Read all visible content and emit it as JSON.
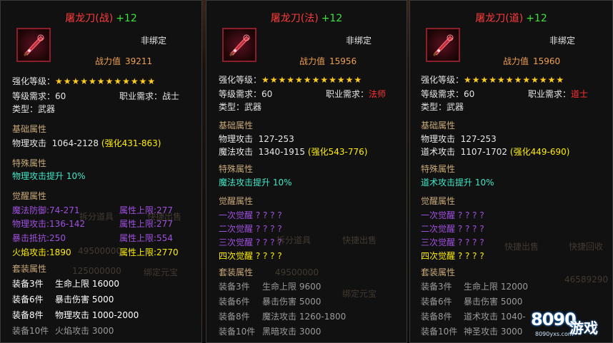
{
  "panels": [
    {
      "name": "屠龙刀(战)",
      "level": "+12",
      "bind": "非绑定",
      "power_label": "战力值",
      "power_value": "39211",
      "enhance_label": "强化等级：",
      "stars": "★★★★★★★★★★★★",
      "level_req": "等级需求：60",
      "class_req_label": "职业需求：",
      "class_req_value": "战士",
      "type": "类型：武器",
      "base_title": "基础属性",
      "base": [
        {
          "k": "物理攻击",
          "v": "1064-2128",
          "enh": "(强化431-863)"
        }
      ],
      "special_title": "特殊属性",
      "special": "物理攻击提升  10%",
      "awaken_title": "觉醒属性",
      "awaken": [
        [
          "魔法防御:74-271",
          "属性上限:277"
        ],
        [
          "物理攻击:136-142",
          "属性上限:277"
        ],
        [
          "暴击抵抗:250",
          "属性上限:554"
        ],
        [
          "火焰攻击:1890",
          "属性上限:2770"
        ]
      ],
      "set_title": "套装属性",
      "set": [
        {
          "k": "装备3件",
          "a": "生命上限",
          "v": "16000",
          "on": true
        },
        {
          "k": "装备6件",
          "a": "暴击伤害",
          "v": "5000",
          "on": true
        },
        {
          "k": "装备8件",
          "a": "物理攻击",
          "v": "1000-2000",
          "on": true
        },
        {
          "k": "装备10件",
          "a": "火焰攻击",
          "v": "3000",
          "on": false
        }
      ]
    },
    {
      "name": "屠龙刀(法)",
      "level": "+12",
      "bind": "非绑定",
      "power_label": "战力值",
      "power_value": "15956",
      "enhance_label": "强化等级：",
      "stars": "★★★★★★★★★★★★",
      "level_req": "等级需求：60",
      "class_req_label": "职业需求：",
      "class_req_value": "法师",
      "type": "类型：武器",
      "base_title": "基础属性",
      "base": [
        {
          "k": "物理攻击",
          "v": "127-253",
          "enh": ""
        },
        {
          "k": "魔法攻击",
          "v": "1340-1915",
          "enh": "(强化543-776)"
        }
      ],
      "special_title": "特殊属性",
      "special": "魔法攻击提升  10%",
      "awaken_title": "觉醒属性",
      "awaken": [
        "一次觉醒 ? ? ? ?",
        "二次觉醒 ? ? ? ?",
        "三次觉醒 ? ? ? ?",
        "四次觉醒 ? ? ? ?"
      ],
      "set_title": "套装属性",
      "set": [
        {
          "k": "装备3件",
          "a": "生命上限",
          "v": "9600",
          "on": false
        },
        {
          "k": "装备6件",
          "a": "暴击伤害",
          "v": "5000",
          "on": false
        },
        {
          "k": "装备8件",
          "a": "魔法攻击",
          "v": "1260-1800",
          "on": false
        },
        {
          "k": "装备10件",
          "a": "黑暗攻击",
          "v": "3000",
          "on": false
        }
      ]
    },
    {
      "name": "屠龙刀(道)",
      "level": "+12",
      "bind": "非绑定",
      "power_label": "战力值",
      "power_value": "15960",
      "enhance_label": "强化等级：",
      "stars": "★★★★★★★★★★★★",
      "level_req": "等级需求：60",
      "class_req_label": "职业需求：",
      "class_req_value": "道士",
      "type": "类型：武器",
      "base_title": "基础属性",
      "base": [
        {
          "k": "物理攻击",
          "v": "127-253",
          "enh": ""
        },
        {
          "k": "道术攻击",
          "v": "1107-1702",
          "enh": "(强化449-690)"
        }
      ],
      "special_title": "特殊属性",
      "special": "道术攻击提升  10%",
      "awaken_title": "觉醒属性",
      "awaken": [
        "一次觉醒 ? ? ? ?",
        "二次觉醒 ? ? ? ?",
        "三次觉醒 ? ? ? ?",
        "四次觉醒 ? ? ? ?"
      ],
      "set_title": "套装属性",
      "set": [
        {
          "k": "装备3件",
          "a": "生命上限",
          "v": "12000",
          "on": false
        },
        {
          "k": "装备6件",
          "a": "暴击伤害",
          "v": "5000",
          "on": false
        },
        {
          "k": "装备8件",
          "a": "道术攻击",
          "v": "1040-",
          "on": false
        },
        {
          "k": "装备10件",
          "a": "神圣攻击",
          "v": "3000",
          "on": false
        }
      ]
    }
  ],
  "background_text": {
    "split_item": "拆分道具",
    "quick_sell": "快捷出售",
    "quick_recycle": "快捷回收",
    "gold1": "49500000",
    "gold2": "125000000",
    "gold3": "46589290",
    "bound_gold": "绑定元宝"
  },
  "watermark": {
    "number": "8090",
    "text": "游戏",
    "url": "8090yxs.com"
  },
  "colors": {
    "title_red": "#ff3c3c",
    "level_green": "#3ce43c",
    "star_gold": "#ffcc22",
    "enhance_yellow": "#ffee00",
    "special_cyan": "#40e8c8",
    "awaken_purple": "#a050e0"
  },
  "icons": {
    "item_icon": "dragon-slayer-blade-icon"
  }
}
